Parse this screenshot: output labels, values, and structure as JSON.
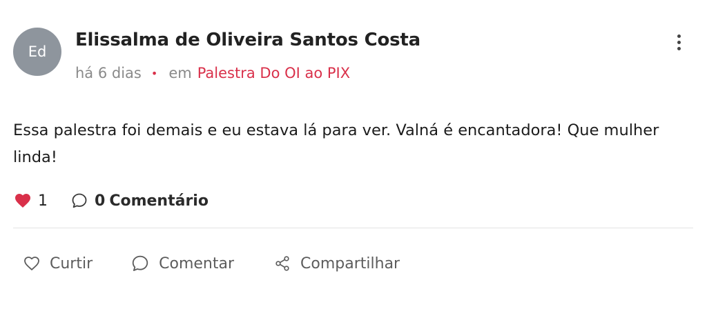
{
  "author": {
    "initials": "Ed",
    "name": "Elissalma de Oliveira Santos Costa"
  },
  "meta": {
    "time": "há 6 dias",
    "separator": "•",
    "in_label": "em",
    "group": "Palestra Do OI ao PIX"
  },
  "post": {
    "text": "Essa palestra foi demais e eu estava lá para ver. Valná é encantadora! Que mulher linda!"
  },
  "stats": {
    "likes": "1",
    "comments_count": "0",
    "comments_label": "Comentário"
  },
  "actions": {
    "like_label": "Curtir",
    "comment_label": "Comentar",
    "share_label": "Compartilhar"
  },
  "icons": {
    "heart": "heart-filled-icon",
    "comment": "speech-bubble-icon",
    "like": "heart-outline-icon",
    "share": "share-icon",
    "menu": "kebab-menu-icon"
  },
  "colors": {
    "accent": "#d9304a",
    "avatar_bg": "#8e959d",
    "muted_text": "#8a8a8a"
  }
}
